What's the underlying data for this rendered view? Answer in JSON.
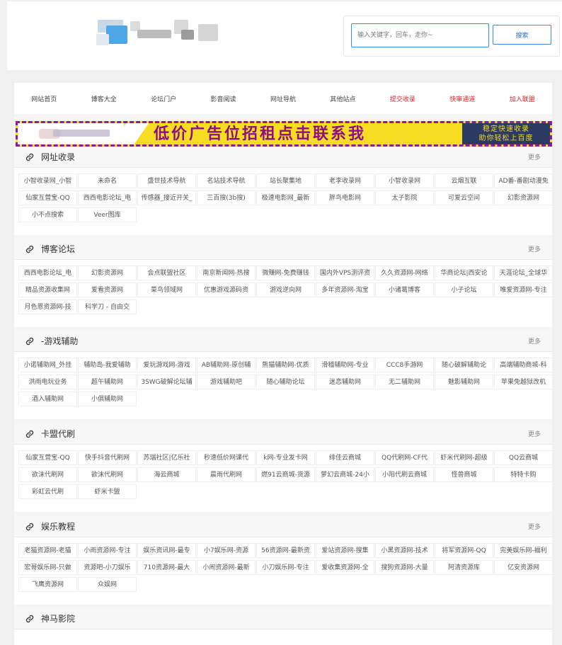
{
  "search": {
    "placeholder": "输入关键字，回车，走你~",
    "button_label": "搜索"
  },
  "nav": [
    "网站首页",
    "博客大全",
    "论坛门户",
    "影音阅读",
    "网址导航",
    "其他站点",
    "提交收录",
    "快审通道",
    "加入联盟"
  ],
  "colors": {
    "accent": "#3b8ce0",
    "nav_highlight": "#e0232a",
    "banner_bg": "#f6dc22",
    "banner_border": "#8c1c9c",
    "banner_text": "#8b0e88",
    "banner_tag_bg": "#2a3a62"
  },
  "banner": {
    "text": "低价广告位招租点击联系我",
    "tag_line1": "稳定快速收录",
    "tag_line2": "助你轻松上百度"
  },
  "sections": [
    {
      "title": "网址收录",
      "more": "更多",
      "icon": "link-icon",
      "items": [
        "小智收录网_小智",
        "未命名",
        "盛世技术导航",
        "名站技术导航",
        "站长聚集地",
        "老李收录网",
        "小智收录网",
        "云烟互联",
        "AD番-番剧动漫免",
        "仙家互营宝-QQ",
        "西西电影论坛_电",
        "传感器_接近开关_",
        "三百搜(3b搜)",
        "极速电影网_最新",
        "胖鸟电影网",
        "太子影院",
        "可爱云空间",
        "幻影资源网",
        "小不点搜索",
        "Veer图库"
      ]
    },
    {
      "title": "博客论坛",
      "more": "更多",
      "icon": "link-icon",
      "items": [
        "西西电影论坛_电",
        "幻影资源网",
        "会点联盟社区",
        "南京新闻网-热搜",
        "微赚网-免费赚钱",
        "国内外VPS测评资",
        "久久资源网-网络",
        "华商论坛|西安论",
        "天涯论坛_全球华",
        "精品资源收集网",
        "爱看资源网",
        "菜鸟领域网",
        "优惠游戏源码资",
        "游戏逆向网",
        "多年资源网-淘宝",
        "小诸葛博客",
        "小子论坛",
        "唯爱资源网-专注",
        "月色恩资源网-技",
        "科学刀 - 自由交"
      ]
    },
    {
      "title": "-游戏辅助",
      "more": "更多",
      "icon": "link-icon",
      "items": [
        "小诺辅助网_外挂",
        "辅助岛-我爱辅助",
        "爱玩游戏网-游戏",
        "AB辅助网-原创辅",
        "熊猫辅助网-优质",
        "滑稽辅助网-专业",
        "CCC8手游网",
        "随心破解辅助论",
        "高端辅助商城-科",
        "洪雨电玩业务",
        "超午辅助网",
        "3SWG破解论坛辅",
        "游戏辅助吧",
        "随心辅助论坛",
        "迷恋辅助网",
        "无二辅助网",
        "魅影辅助网",
        "苹果免越狱改机",
        "酒入辅助网",
        "小俱辅助网"
      ]
    },
    {
      "title": "卡盟代刷",
      "more": "更多",
      "icon": "link-icon",
      "items": [
        "仙家互营宝-QQ",
        "快手抖音代刷网",
        "苏瑞社区|亿乐社",
        "秒速低价网课代",
        "k网-专业发卡网",
        "绯佳云商城",
        "QQ代刷网-CF代",
        "虾米代刷网-超级",
        "QQ云商城",
        "欲沫代刷网",
        "欲沫代刷网",
        "海云商城",
        "晨雨代刷网",
        "燃91云商城-货源",
        "萝幻云商城-24小",
        "小阳代刷云商城",
        "怪兽商城",
        "特特卡购",
        "彩虹云代刷",
        "虾米卡盟"
      ]
    },
    {
      "title": "娱乐教程",
      "more": "更多",
      "icon": "link-icon",
      "items": [
        "老猫资源网-老猫",
        "小雨资源网-专注",
        "娱乐资讯网-最专",
        "小7娱乐网-资源",
        "56资源网-最新资",
        "爱站资源网-搜集",
        "小黑资源网-技术",
        "将军资源网-QQ",
        "完美娱乐网-福利",
        "宏哥娱乐网-只做",
        "资源吧-小刀娱乐",
        "710资源网-最大",
        "小闹资源网-最新",
        "小刀娱乐网-专注",
        "爱收集资源网-全",
        "搜狗资源网-大量",
        "阿清资源库",
        "亿安资源网",
        "飞鹰资源网",
        "众娱网"
      ]
    },
    {
      "title": "神马影院",
      "more": "",
      "icon": "link-icon",
      "items": []
    }
  ]
}
